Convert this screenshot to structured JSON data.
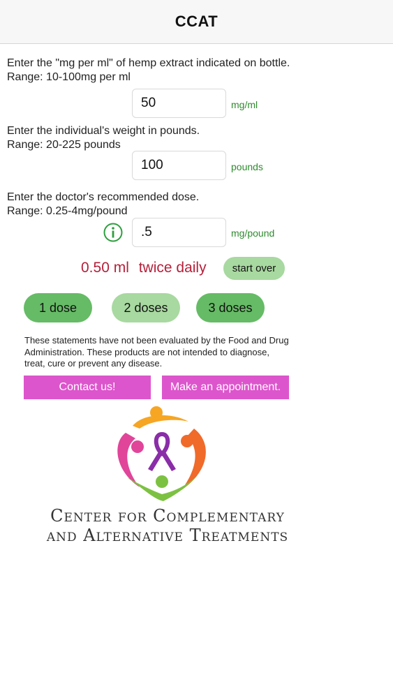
{
  "app": {
    "title": "CCAT"
  },
  "form": {
    "concentration": {
      "prompt": "Enter the \"mg per ml\" of hemp extract indicated on bottle. Range: 10-100mg per ml",
      "value": "50",
      "unit": "mg/ml"
    },
    "weight": {
      "prompt_line1": "Enter the individual's weight in pounds.",
      "prompt_line2": "Range: 20-225 pounds",
      "value": "100",
      "unit": "pounds"
    },
    "dose": {
      "prompt_line1": "Enter the doctor's recommended dose.",
      "prompt_line2": "Range: 0.25-4mg/pound",
      "value": ".5",
      "unit": "mg/pound"
    }
  },
  "result": {
    "amount": "0.50 ml",
    "frequency": "twice daily",
    "start_over_label": "start over"
  },
  "dose_buttons": [
    "1 dose",
    "2 doses",
    "3 doses"
  ],
  "disclaimer": "These statements have not been evaluated by the Food and Drug Administration. These products are not intended to diagnose, treat, cure or prevent any disease.",
  "links": {
    "contact_label": "Contact us!",
    "appointment_label": "Make an appointment."
  },
  "brand": {
    "name_line1": "Center for Complementary",
    "name_line2": "and Alternative Treatments"
  },
  "colors": {
    "accent_green": "#66bb66",
    "light_green": "#a8d9a0",
    "result_red": "#b5203a",
    "magenta": "#dd55cc"
  },
  "icons": {
    "info": "info-icon",
    "logo": "heart-ribbon-logo"
  }
}
